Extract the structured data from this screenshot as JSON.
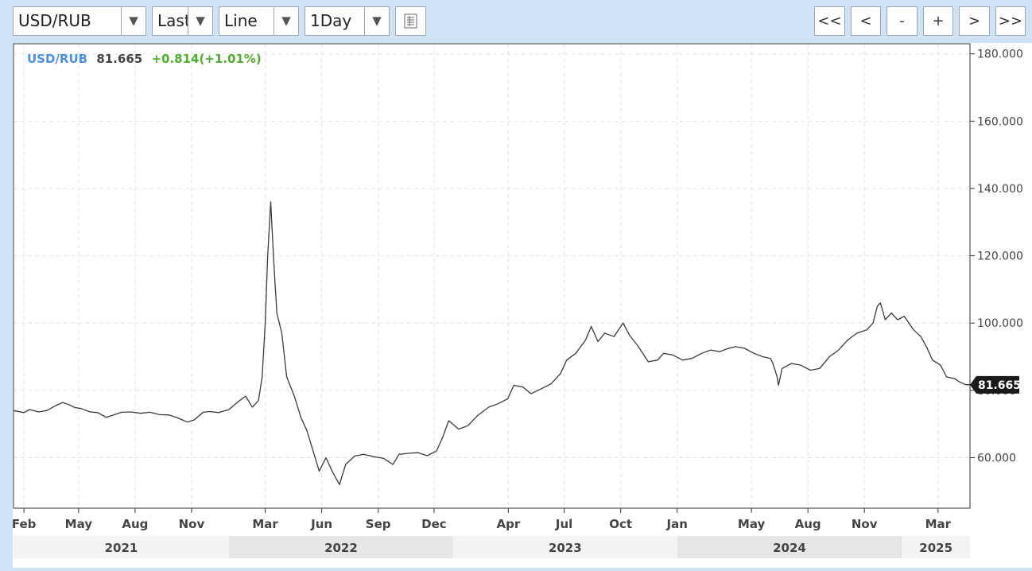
{
  "toolbar": {
    "symbol": "USD/RUB",
    "price_type": "Last",
    "chart_style": "Line",
    "interval": "1Day",
    "nav": {
      "first": "<<",
      "prev": "<",
      "zoom_out": "-",
      "zoom_in": "+",
      "next": ">",
      "last": ">>"
    }
  },
  "header": {
    "symbol": "USD/RUB",
    "last": "81.665",
    "change": "+0.814(+1.01%)"
  },
  "colors": {
    "symbol": "#4a8fe8",
    "up": "#4caf2a",
    "line": "#3a3a3a",
    "grid": "#e2e2e2",
    "bg": "#cfe2f6"
  },
  "chart_data": {
    "type": "line",
    "title": "",
    "xlabel": "",
    "ylabel": "",
    "ylim": [
      45,
      183
    ],
    "yticks": [
      60,
      80,
      100,
      120,
      140,
      160,
      180
    ],
    "ytick_labels": [
      "60.000",
      "80.000",
      "100.000",
      "120.000",
      "140.000",
      "160.000",
      "180.000"
    ],
    "xlim": [
      "2021-01-15",
      "2025-04-22"
    ],
    "xticks": [
      {
        "date": "2021-02-01",
        "label": "Feb"
      },
      {
        "date": "2021-05-01",
        "label": "May"
      },
      {
        "date": "2021-08-01",
        "label": "Aug"
      },
      {
        "date": "2021-11-01",
        "label": "Nov"
      },
      {
        "date": "2022-03-01",
        "label": "Mar"
      },
      {
        "date": "2022-06-01",
        "label": "Jun"
      },
      {
        "date": "2022-09-01",
        "label": "Sep"
      },
      {
        "date": "2022-12-01",
        "label": "Dec"
      },
      {
        "date": "2023-04-01",
        "label": "Apr"
      },
      {
        "date": "2023-07-01",
        "label": "Jul"
      },
      {
        "date": "2023-10-01",
        "label": "Oct"
      },
      {
        "date": "2024-01-01",
        "label": "Jan"
      },
      {
        "date": "2024-05-01",
        "label": "May"
      },
      {
        "date": "2024-08-01",
        "label": "Aug"
      },
      {
        "date": "2024-11-01",
        "label": "Nov"
      },
      {
        "date": "2025-03-01",
        "label": "Mar"
      }
    ],
    "years": [
      {
        "label": "2021",
        "start": "2021-01-15",
        "end": "2022-01-01"
      },
      {
        "label": "2022",
        "start": "2022-01-01",
        "end": "2023-01-01"
      },
      {
        "label": "2023",
        "start": "2023-01-01",
        "end": "2024-01-01"
      },
      {
        "label": "2024",
        "start": "2024-01-01",
        "end": "2025-01-01"
      },
      {
        "label": "2025",
        "start": "2025-01-01",
        "end": "2025-04-22"
      }
    ],
    "grid": true,
    "last_value_label": "81.665",
    "series": [
      {
        "name": "USD/RUB",
        "points": [
          [
            "2021-01-15",
            74.0
          ],
          [
            "2021-02-01",
            73.4
          ],
          [
            "2021-02-10",
            74.3
          ],
          [
            "2021-02-25",
            73.6
          ],
          [
            "2021-03-10",
            74.0
          ],
          [
            "2021-03-25",
            75.5
          ],
          [
            "2021-04-05",
            76.4
          ],
          [
            "2021-04-15",
            75.8
          ],
          [
            "2021-04-25",
            74.9
          ],
          [
            "2021-05-05",
            74.6
          ],
          [
            "2021-05-20",
            73.6
          ],
          [
            "2021-06-01",
            73.4
          ],
          [
            "2021-06-15",
            72.0
          ],
          [
            "2021-06-25",
            72.6
          ],
          [
            "2021-07-10",
            73.5
          ],
          [
            "2021-07-25",
            73.6
          ],
          [
            "2021-08-10",
            73.2
          ],
          [
            "2021-08-25",
            73.5
          ],
          [
            "2021-09-10",
            72.8
          ],
          [
            "2021-09-25",
            72.7
          ],
          [
            "2021-10-10",
            71.8
          ],
          [
            "2021-10-25",
            70.6
          ],
          [
            "2021-11-05",
            71.2
          ],
          [
            "2021-11-20",
            73.5
          ],
          [
            "2021-12-01",
            73.7
          ],
          [
            "2021-12-15",
            73.4
          ],
          [
            "2022-01-01",
            74.3
          ],
          [
            "2022-01-15",
            76.5
          ],
          [
            "2022-01-28",
            78.3
          ],
          [
            "2022-02-08",
            75.0
          ],
          [
            "2022-02-18",
            77.0
          ],
          [
            "2022-02-24",
            84.0
          ],
          [
            "2022-03-01",
            100.0
          ],
          [
            "2022-03-05",
            120.0
          ],
          [
            "2022-03-10",
            136.0
          ],
          [
            "2022-03-15",
            118.0
          ],
          [
            "2022-03-20",
            103.0
          ],
          [
            "2022-03-28",
            97.0
          ],
          [
            "2022-04-05",
            84.0
          ],
          [
            "2022-04-18",
            78.0
          ],
          [
            "2022-04-28",
            72.0
          ],
          [
            "2022-05-08",
            68.0
          ],
          [
            "2022-05-18",
            62.0
          ],
          [
            "2022-05-28",
            56.0
          ],
          [
            "2022-06-08",
            60.0
          ],
          [
            "2022-06-18",
            56.0
          ],
          [
            "2022-06-30",
            52.0
          ],
          [
            "2022-07-10",
            58.0
          ],
          [
            "2022-07-25",
            60.5
          ],
          [
            "2022-08-08",
            61.0
          ],
          [
            "2022-08-25",
            60.3
          ],
          [
            "2022-09-10",
            59.8
          ],
          [
            "2022-09-25",
            58.0
          ],
          [
            "2022-10-05",
            61.0
          ],
          [
            "2022-10-20",
            61.3
          ],
          [
            "2022-11-05",
            61.5
          ],
          [
            "2022-11-20",
            60.6
          ],
          [
            "2022-12-05",
            62.0
          ],
          [
            "2022-12-15",
            66.0
          ],
          [
            "2022-12-25",
            71.0
          ],
          [
            "2023-01-10",
            68.5
          ],
          [
            "2023-01-25",
            69.5
          ],
          [
            "2023-02-10",
            72.5
          ],
          [
            "2023-02-28",
            75.0
          ],
          [
            "2023-03-15",
            76.0
          ],
          [
            "2023-03-31",
            77.5
          ],
          [
            "2023-04-10",
            81.5
          ],
          [
            "2023-04-25",
            81.0
          ],
          [
            "2023-05-08",
            79.0
          ],
          [
            "2023-05-25",
            80.5
          ],
          [
            "2023-06-10",
            82.0
          ],
          [
            "2023-06-25",
            85.0
          ],
          [
            "2023-07-05",
            89.0
          ],
          [
            "2023-07-20",
            91.0
          ],
          [
            "2023-08-05",
            95.0
          ],
          [
            "2023-08-14",
            99.0
          ],
          [
            "2023-08-25",
            94.5
          ],
          [
            "2023-09-05",
            97.0
          ],
          [
            "2023-09-20",
            96.0
          ],
          [
            "2023-10-05",
            100.0
          ],
          [
            "2023-10-15",
            96.5
          ],
          [
            "2023-10-30",
            93.0
          ],
          [
            "2023-11-15",
            88.5
          ],
          [
            "2023-11-30",
            89.0
          ],
          [
            "2023-12-10",
            91.0
          ],
          [
            "2023-12-25",
            90.5
          ],
          [
            "2024-01-10",
            89.0
          ],
          [
            "2024-01-25",
            89.5
          ],
          [
            "2024-02-10",
            91.0
          ],
          [
            "2024-02-25",
            92.0
          ],
          [
            "2024-03-10",
            91.5
          ],
          [
            "2024-03-25",
            92.5
          ],
          [
            "2024-04-05",
            93.0
          ],
          [
            "2024-04-20",
            92.5
          ],
          [
            "2024-05-05",
            91.0
          ],
          [
            "2024-05-20",
            90.0
          ],
          [
            "2024-06-01",
            89.5
          ],
          [
            "2024-06-05",
            88.0
          ],
          [
            "2024-06-12",
            84.0
          ],
          [
            "2024-06-14",
            81.5
          ],
          [
            "2024-06-20",
            86.5
          ],
          [
            "2024-07-05",
            88.0
          ],
          [
            "2024-07-20",
            87.5
          ],
          [
            "2024-08-05",
            86.0
          ],
          [
            "2024-08-20",
            86.5
          ],
          [
            "2024-09-05",
            90.0
          ],
          [
            "2024-09-20",
            92.0
          ],
          [
            "2024-10-05",
            95.0
          ],
          [
            "2024-10-20",
            97.0
          ],
          [
            "2024-11-05",
            98.0
          ],
          [
            "2024-11-15",
            100.0
          ],
          [
            "2024-11-22",
            105.0
          ],
          [
            "2024-11-27",
            106.0
          ],
          [
            "2024-12-05",
            101.0
          ],
          [
            "2024-12-15",
            103.0
          ],
          [
            "2024-12-25",
            101.0
          ],
          [
            "2025-01-05",
            102.0
          ],
          [
            "2025-01-20",
            98.0
          ],
          [
            "2025-02-01",
            96.0
          ],
          [
            "2025-02-10",
            93.0
          ],
          [
            "2025-02-20",
            89.0
          ],
          [
            "2025-03-05",
            87.5
          ],
          [
            "2025-03-15",
            84.0
          ],
          [
            "2025-03-28",
            83.5
          ],
          [
            "2025-04-05",
            82.5
          ],
          [
            "2025-04-15",
            81.7
          ],
          [
            "2025-04-22",
            81.665
          ]
        ]
      }
    ]
  }
}
